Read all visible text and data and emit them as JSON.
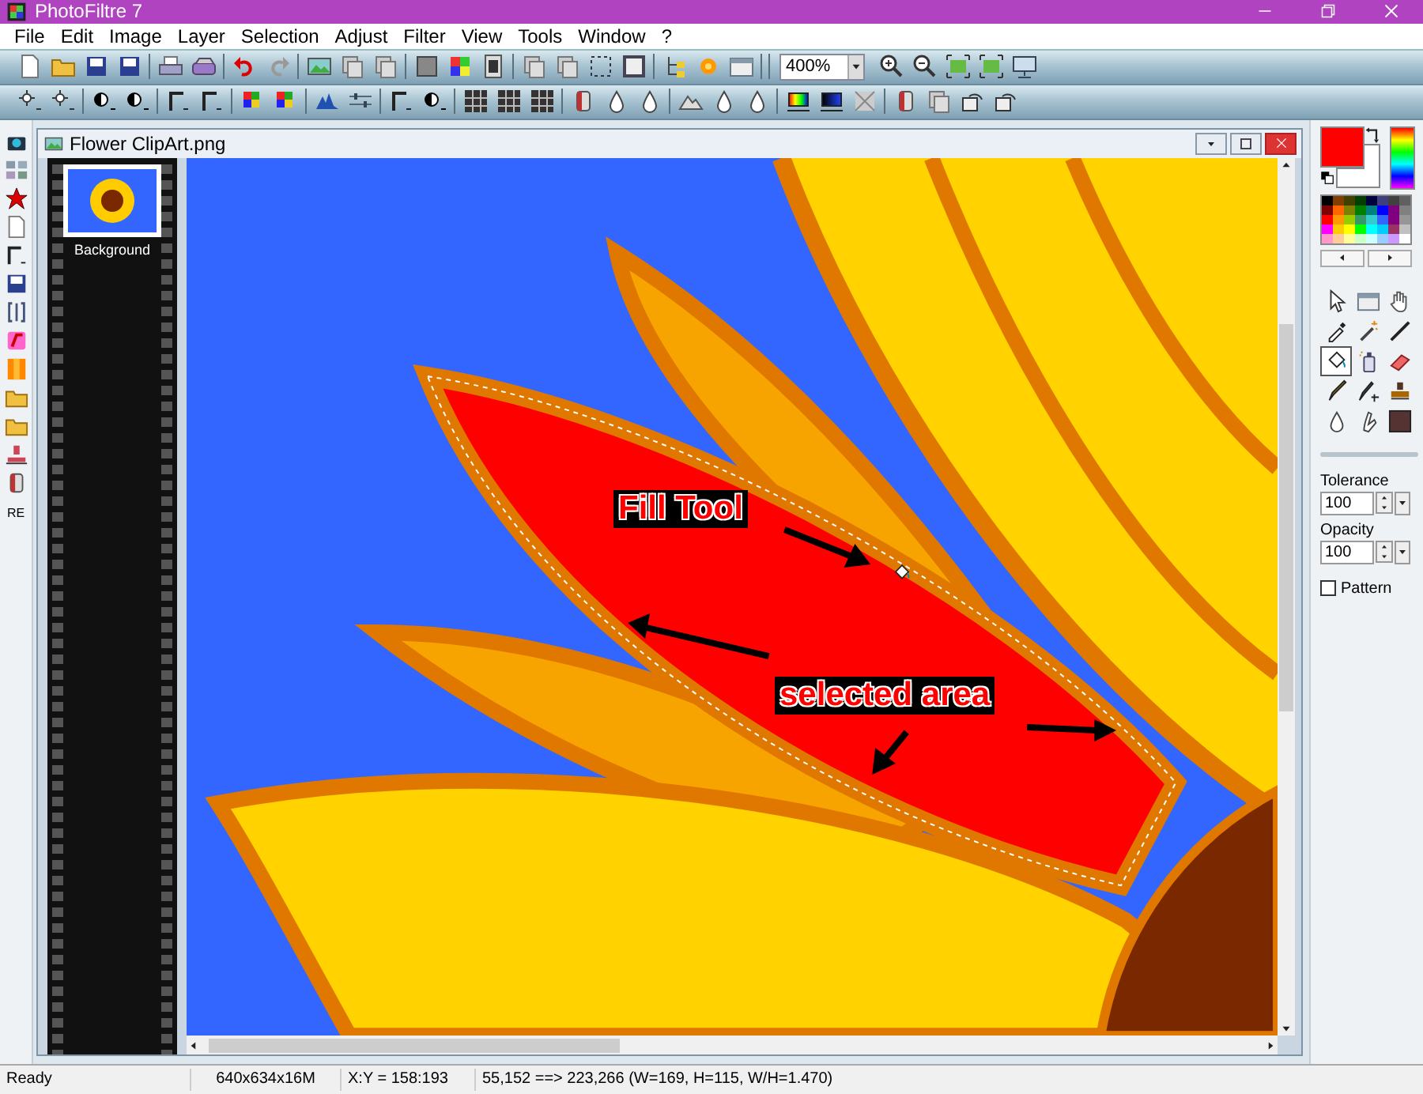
{
  "window": {
    "title": "PhotoFiltre 7"
  },
  "menu": [
    "File",
    "Edit",
    "Image",
    "Layer",
    "Selection",
    "Adjust",
    "Filter",
    "View",
    "Tools",
    "Window",
    "?"
  ],
  "toolbar": {
    "zoom": "400%"
  },
  "left_toolbar": {
    "label": "RE"
  },
  "document": {
    "title": "Flower ClipArt.png",
    "layers": [
      {
        "name": "Background"
      }
    ],
    "annotations": [
      {
        "text": "Fill Tool"
      },
      {
        "text": "selected area"
      }
    ]
  },
  "colors": {
    "foreground": {
      "color": "#ff0000"
    },
    "background": {
      "color": "#ffffff"
    },
    "palette": [
      {
        "color": "#000000"
      },
      {
        "color": "#7f3f00"
      },
      {
        "color": "#404000"
      },
      {
        "color": "#003f00"
      },
      {
        "color": "#00003f"
      },
      {
        "color": "#3f3f7f"
      },
      {
        "color": "#404040"
      },
      {
        "color": "#606060"
      },
      {
        "color": "#7f0000"
      },
      {
        "color": "#ff6600"
      },
      {
        "color": "#7f7f00"
      },
      {
        "color": "#008000"
      },
      {
        "color": "#008080"
      },
      {
        "color": "#0000ff"
      },
      {
        "color": "#7f007f"
      },
      {
        "color": "#808080"
      },
      {
        "color": "#ff0000"
      },
      {
        "color": "#ff9900"
      },
      {
        "color": "#99cc00"
      },
      {
        "color": "#339966"
      },
      {
        "color": "#33cccc"
      },
      {
        "color": "#3366ff"
      },
      {
        "color": "#800080"
      },
      {
        "color": "#969696"
      },
      {
        "color": "#ff00ff"
      },
      {
        "color": "#ffcc00"
      },
      {
        "color": "#ffff00"
      },
      {
        "color": "#00ff00"
      },
      {
        "color": "#00ffff"
      },
      {
        "color": "#00ccff"
      },
      {
        "color": "#993366"
      },
      {
        "color": "#c0c0c0"
      },
      {
        "color": "#ff99cc"
      },
      {
        "color": "#ffcc99"
      },
      {
        "color": "#ffff99"
      },
      {
        "color": "#ccffcc"
      },
      {
        "color": "#ccffff"
      },
      {
        "color": "#99ccff"
      },
      {
        "color": "#cc99ff"
      },
      {
        "color": "#ffffff"
      }
    ]
  },
  "tools": [
    {
      "selected": false
    },
    {
      "selected": false
    },
    {
      "selected": false
    },
    {
      "selected": false
    },
    {
      "selected": false
    },
    {
      "selected": false
    },
    {
      "selected": true
    },
    {
      "selected": false
    },
    {
      "selected": false
    },
    {
      "selected": false
    },
    {
      "selected": false
    },
    {
      "selected": false
    },
    {
      "selected": false
    },
    {
      "selected": false
    },
    {
      "selected": false
    }
  ],
  "tolerance": {
    "label": "Tolerance",
    "value": "100"
  },
  "opacity": {
    "label": "Opacity",
    "value": "100"
  },
  "pattern": {
    "label": "Pattern",
    "checked": false
  },
  "status_bar": [
    "Ready",
    "640x634x16M",
    "X:Y = 158:193",
    "55,152 ==> 223,266 (W=169, H=115, W/H=1.470)"
  ]
}
